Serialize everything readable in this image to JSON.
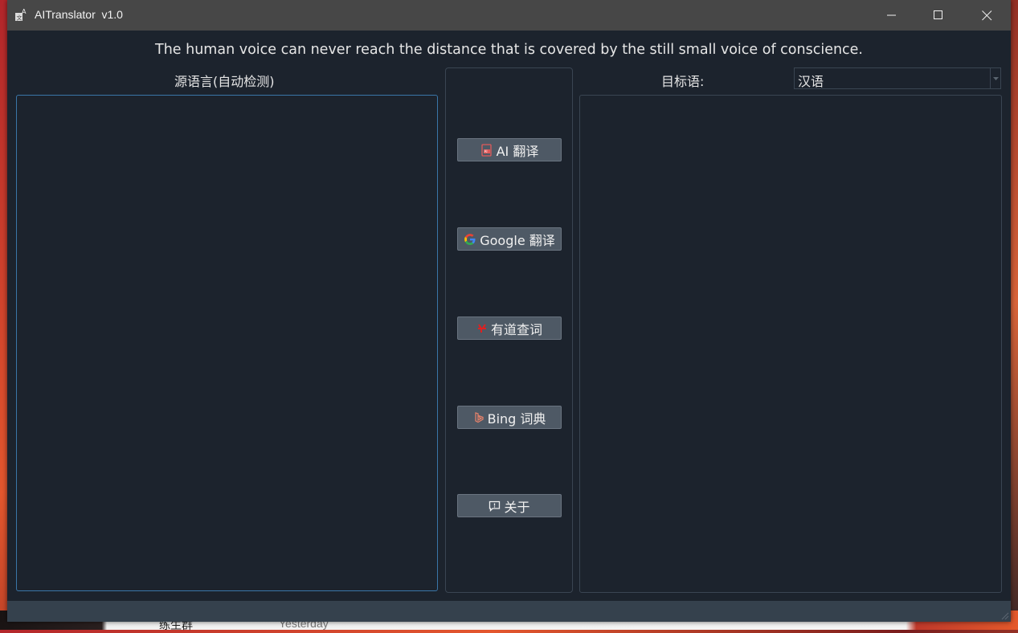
{
  "window": {
    "title": "AITranslator  v1.0",
    "controls": {
      "minimize": "minimize",
      "maximize": "maximize",
      "close": "close"
    }
  },
  "quote": "The human voice can never reach the distance that is covered by the still small voice of conscience.",
  "source": {
    "label": "源语言(自动检测)",
    "text": ""
  },
  "target": {
    "label": "目标语:",
    "language": "汉语",
    "text": ""
  },
  "actions": [
    {
      "label": "AI 翻译",
      "icon": "ai-translate-icon",
      "color": "#e05a5a"
    },
    {
      "label": "Google 翻译",
      "icon": "google-icon",
      "color": "#4285f4"
    },
    {
      "label": "有道查词",
      "icon": "youdao-icon",
      "color": "#e02020"
    },
    {
      "label": "Bing 词典",
      "icon": "bing-icon",
      "color": "#e0806a"
    },
    {
      "label": "关于",
      "icon": "chat-bubble-icon",
      "color": "#f0f0f0"
    }
  ],
  "desktop": {
    "bottom_name": "练生群",
    "bottom_time": "Yesterday"
  },
  "colors": {
    "background": "#1c232d",
    "titlebar": "#474747",
    "button": "#4e5965",
    "statusbar": "#35414d",
    "focus_border": "#3a76a8"
  }
}
